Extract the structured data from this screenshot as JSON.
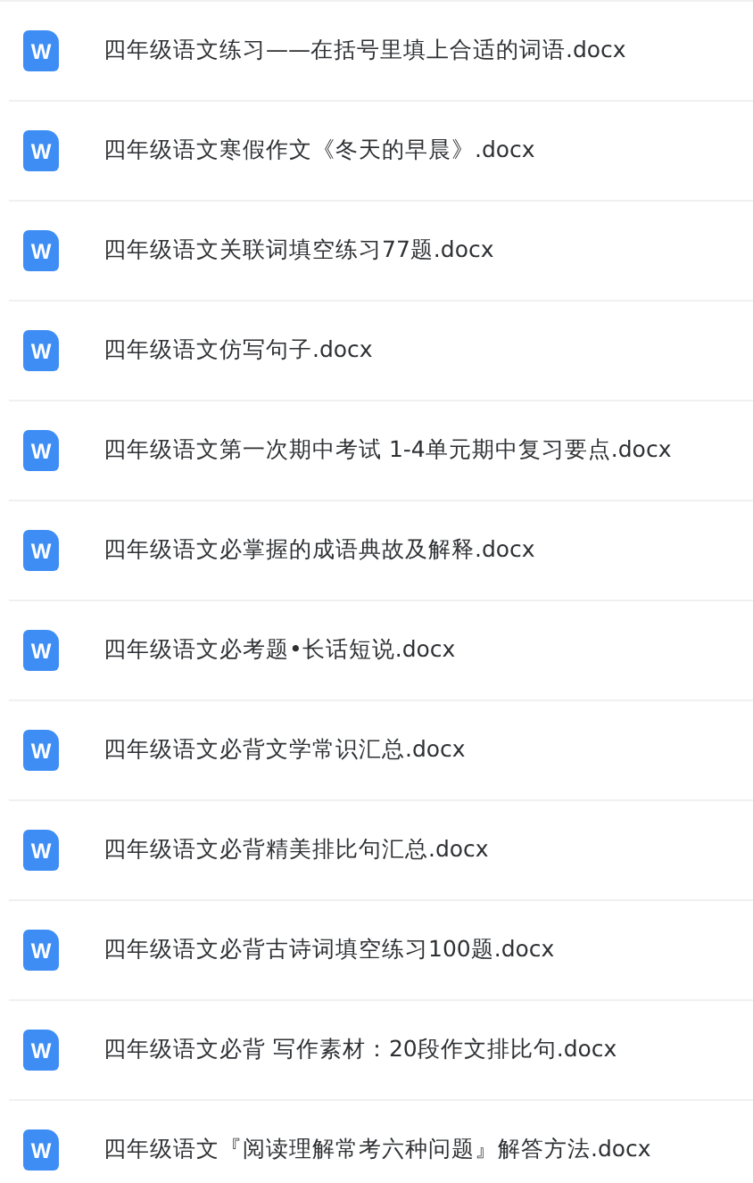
{
  "files": [
    {
      "icon": "W",
      "name": "四年级语文练习——在括号里填上合适的词语.docx"
    },
    {
      "icon": "W",
      "name": "四年级语文寒假作文《冬天的早晨》.docx"
    },
    {
      "icon": "W",
      "name": "四年级语文关联词填空练习77题.docx"
    },
    {
      "icon": "W",
      "name": "四年级语文仿写句子.docx"
    },
    {
      "icon": "W",
      "name": "四年级语文第一次期中考试 1-4单元期中复习要点.docx"
    },
    {
      "icon": "W",
      "name": "四年级语文必掌握的成语典故及解释.docx"
    },
    {
      "icon": "W",
      "name": "四年级语文必考题•长话短说.docx"
    },
    {
      "icon": "W",
      "name": "四年级语文必背文学常识汇总.docx"
    },
    {
      "icon": "W",
      "name": "四年级语文必背精美排比句汇总.docx"
    },
    {
      "icon": "W",
      "name": "四年级语文必背古诗词填空练习100题.docx"
    },
    {
      "icon": "W",
      "name": "四年级语文必背 写作素材：20段作文排比句.docx"
    },
    {
      "icon": "W",
      "name": "四年级语文『阅读理解常考六种问题』解答方法.docx"
    }
  ]
}
